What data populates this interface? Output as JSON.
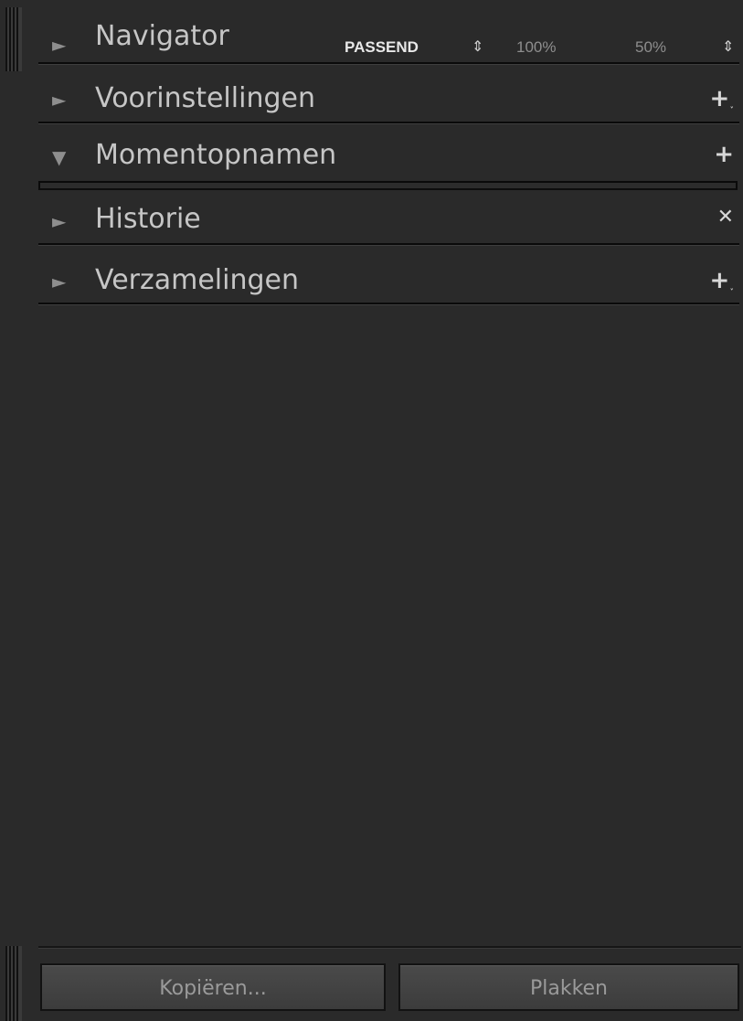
{
  "sections": {
    "navigator": {
      "title": "Navigator",
      "expanded": false,
      "zoom_options": [
        "PASSEND",
        "100%",
        "50%"
      ],
      "stepper_icon": "up-down-chevron-icon"
    },
    "presets": {
      "title": "Voorinstellingen",
      "expanded": false,
      "action_icon": "add-dropdown-icon"
    },
    "snapshots": {
      "title": "Momentopnamen",
      "expanded": true,
      "action_icon": "add-icon"
    },
    "history": {
      "title": "Historie",
      "expanded": false,
      "action_icon": "clear-icon"
    },
    "collections": {
      "title": "Verzamelingen",
      "expanded": false,
      "action_icon": "add-dropdown-icon"
    }
  },
  "buttons": {
    "copy_label": "Kopiëren...",
    "paste_label": "Plakken"
  },
  "colors": {
    "panel_bg": "#2a2a2a",
    "title_text": "#c6c6c6",
    "triangle": "#8e8e8e",
    "zoom_active": "#e8e8e8",
    "zoom_inactive": "#8e8e8e"
  }
}
